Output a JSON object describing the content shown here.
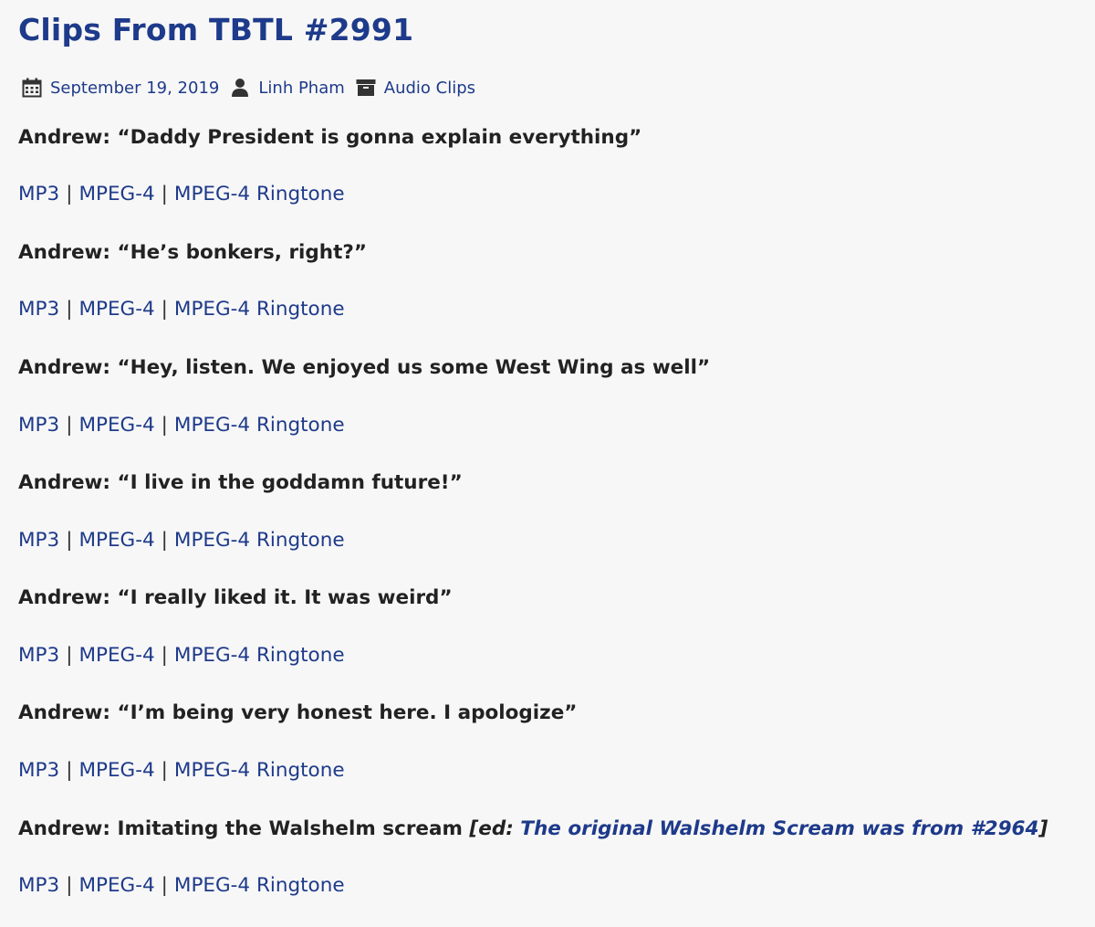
{
  "post": {
    "title": "Clips From TBTL #2991",
    "meta": {
      "date": "September 19, 2019",
      "author": "Linh Pham",
      "category": "Audio Clips"
    },
    "link_labels": {
      "mp3": "MP3",
      "mpeg4": "MPEG-4",
      "ringtone": "MPEG-4 Ringtone",
      "separator": "|"
    },
    "clips": [
      {
        "quote": "Andrew: “Daddy President is gonna explain everything”"
      },
      {
        "quote": "Andrew: “He’s bonkers, right?”"
      },
      {
        "quote": "Andrew: “Hey, listen. We enjoyed us some West Wing as well”"
      },
      {
        "quote": "Andrew: “I live in the goddamn future!”"
      },
      {
        "quote": "Andrew: “I really liked it. It was weird”"
      },
      {
        "quote": "Andrew: “I’m being very honest here. I apologize”"
      },
      {
        "quote": "Andrew: Imitating the Walshelm scream ",
        "ed_open": "[ed: ",
        "ed_link": "The original Walshelm Scream was from #2964",
        "ed_close": "]"
      }
    ]
  }
}
